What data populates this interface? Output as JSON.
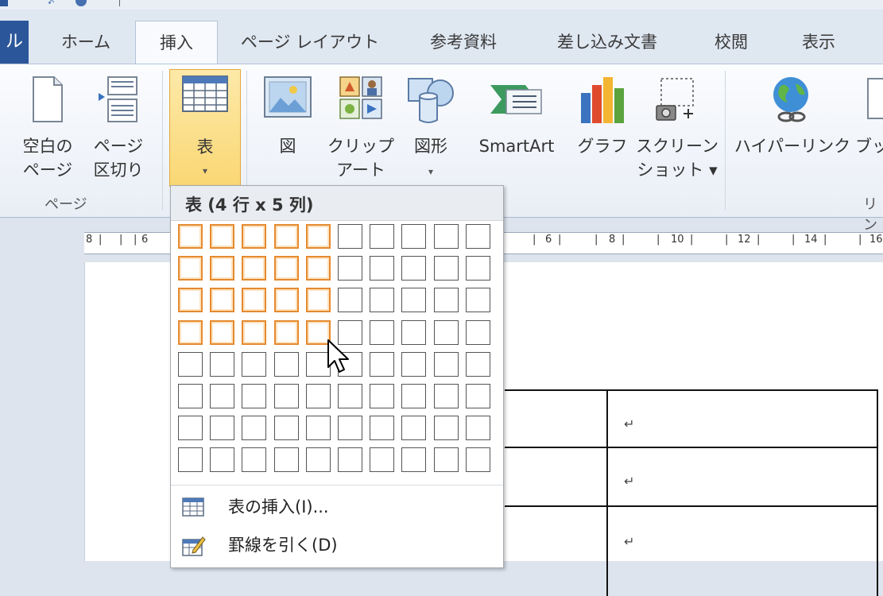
{
  "tabs": [
    {
      "id": "file",
      "label": "ル"
    },
    {
      "id": "home",
      "label": "ホーム"
    },
    {
      "id": "insert",
      "label": "挿入"
    },
    {
      "id": "page-layout",
      "label": "ページ レイアウト"
    },
    {
      "id": "references",
      "label": "参考資料"
    },
    {
      "id": "mailings",
      "label": "差し込み文書"
    },
    {
      "id": "review",
      "label": "校閲"
    },
    {
      "id": "view",
      "label": "表示"
    }
  ],
  "ribbon": {
    "pages_group": {
      "blank_page_line1": "空白の",
      "blank_page_line2": "ページ",
      "page_break_line1": "ページ",
      "page_break_line2": "区切り",
      "label": "ページ"
    },
    "table": {
      "label": "表",
      "dropdown_arrow": "▾"
    },
    "picture": {
      "label": "図"
    },
    "clip_art": {
      "line1": "クリップ",
      "line2": "アート"
    },
    "shapes": {
      "label": "図形",
      "dropdown_arrow": "▾"
    },
    "smartart": {
      "label": "SmartArt"
    },
    "chart": {
      "label": "グラフ"
    },
    "screenshot": {
      "line1": "スクリーン",
      "line2": "ショット ▾"
    },
    "hyperlink": {
      "label": "ハイパーリンク"
    },
    "bookmark": {
      "label": "ブック"
    },
    "links_group": {
      "label": "リン"
    }
  },
  "ruler": {
    "left_labels": [
      "8",
      "6"
    ],
    "right_labels": [
      "6",
      "8",
      "10",
      "12",
      "14",
      "16"
    ]
  },
  "dropdown": {
    "header": "表 (4 行 x 5 列)",
    "grid": {
      "rows": 8,
      "cols": 10,
      "selected_rows": 4,
      "selected_cols": 5
    },
    "insert_table": "表の挿入(I)...",
    "draw_table": "罫線を引く(D)"
  },
  "document": {
    "paragraph_mark": "↵"
  },
  "colors": {
    "file_tab": "#2b579a",
    "highlight_fill": "#f9d774",
    "highlight_border": "#e3a93a",
    "grid_selected": "#e58a2e"
  }
}
